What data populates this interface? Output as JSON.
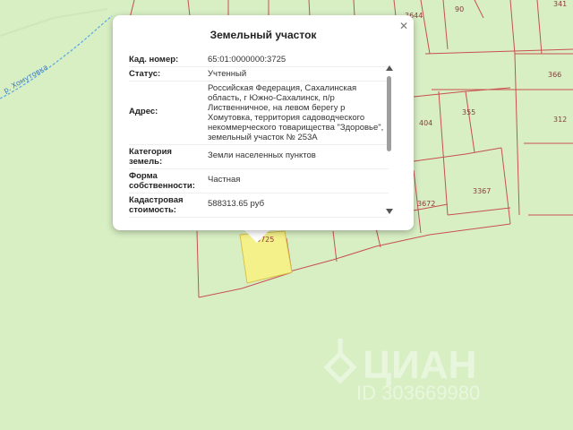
{
  "map": {
    "river_label": "р. Хомутовка",
    "parcel_labels": {
      "p3644": "3644",
      "p90": "90",
      "p341": "341",
      "p366": "366",
      "p312": "312",
      "p404": "404",
      "p355": "355",
      "p3367": "3367",
      "p3672": "3672",
      "p3725": "3725"
    },
    "watermark_brand": "ЦИАН",
    "watermark_id": "ID 303669980",
    "colors": {
      "land": "#d8efc4",
      "boundary": "#c75050",
      "selected_parcel": "#f4f08a",
      "river": "#5aa6e6"
    }
  },
  "popup": {
    "title": "Земельный участок",
    "rows": [
      {
        "key": "Кад. номер:",
        "value": "65:01:0000000:3725"
      },
      {
        "key": "Статус:",
        "value": "Учтенный"
      },
      {
        "key": "Адрес:",
        "value": "Российская Федерация, Сахалинская область, г Южно-Сахалинск, п/р Лиственничное, на левом берегу р Хомутовка, территория садоводческого некоммерческого товарищества \"Здоровье\", земельный участок № 253А"
      },
      {
        "key": "Категория земель:",
        "value": "Земли населенных пунктов"
      },
      {
        "key": "Форма собственности:",
        "value": "Частная"
      },
      {
        "key": "Кадастровая стоимость:",
        "value": "588313.65 руб"
      }
    ],
    "close_icon": "close-icon"
  }
}
